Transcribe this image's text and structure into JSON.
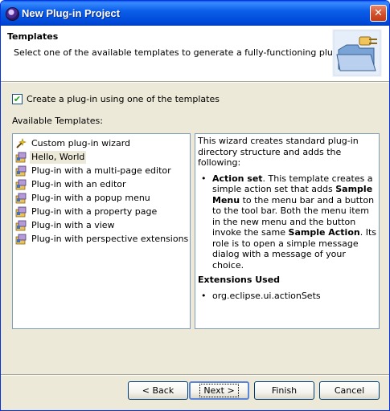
{
  "window": {
    "title": "New Plug-in Project",
    "close_glyph": "✕"
  },
  "header": {
    "title": "Templates",
    "description": "Select one of the available templates to generate a fully-functioning plug-in."
  },
  "checkbox": {
    "label": "Create a plug-in using one of the templates",
    "checked": true,
    "check_glyph": "✔"
  },
  "templates": {
    "label": "Available Templates:",
    "items": [
      {
        "label": "Custom plug-in wizard",
        "icon": "custom-wizard-icon"
      },
      {
        "label": "Hello, World",
        "icon": "template-icon",
        "selected": true
      },
      {
        "label": "Plug-in with a multi-page editor",
        "icon": "template-icon"
      },
      {
        "label": "Plug-in with an editor",
        "icon": "template-icon"
      },
      {
        "label": "Plug-in with a popup menu",
        "icon": "template-icon"
      },
      {
        "label": "Plug-in with a property page",
        "icon": "template-icon"
      },
      {
        "label": "Plug-in with a view",
        "icon": "template-icon"
      },
      {
        "label": "Plug-in with perspective extensions",
        "icon": "template-icon"
      }
    ]
  },
  "description": {
    "intro": "This wizard creates standard plug-in directory structure and adds the following:",
    "bullet_title": "Action set",
    "bullet_text_1": ". This template creates a simple action set that adds ",
    "bullet_bold_1": "Sample Menu",
    "bullet_text_2": " to the menu bar and a button to the tool bar. Both the menu item in the new menu and the button invoke the same ",
    "bullet_bold_2": "Sample Action",
    "bullet_text_3": ". Its role is to open a simple message dialog with a message of your choice.",
    "extensions_heading": "Extensions Used",
    "extension_item": "org.eclipse.ui.actionSets"
  },
  "buttons": {
    "back": "< Back",
    "next": "Next >",
    "finish": "Finish",
    "cancel": "Cancel"
  }
}
